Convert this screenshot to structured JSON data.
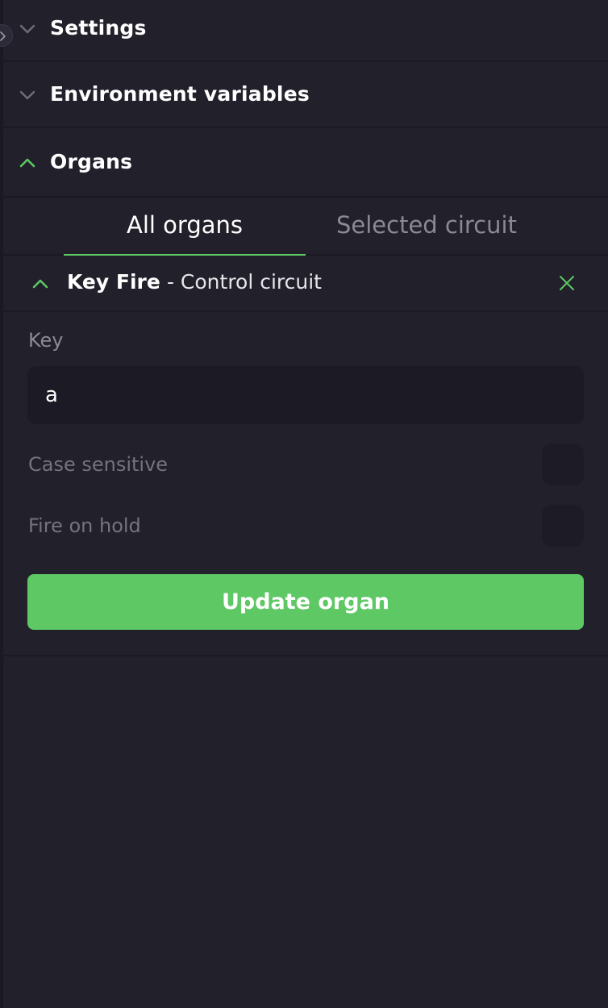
{
  "sections": {
    "settings": {
      "title": "Settings",
      "expanded": false
    },
    "environment": {
      "title": "Environment variables",
      "expanded": false
    },
    "organs": {
      "title": "Organs",
      "expanded": true
    }
  },
  "tabs": [
    {
      "label": "All organs",
      "active": true
    },
    {
      "label": "Selected circuit",
      "active": false
    }
  ],
  "organ": {
    "name": "Key Fire",
    "separator_text": " - Control circuit",
    "expanded": true
  },
  "form": {
    "key_label": "Key",
    "key_value": "a",
    "case_sensitive_label": "Case sensitive",
    "case_sensitive_checked": false,
    "fire_on_hold_label": "Fire on hold",
    "fire_on_hold_checked": false,
    "submit_label": "Update organ"
  },
  "colors": {
    "background": "#21202b",
    "accent": "#5ec864",
    "muted_text": "#8a8995"
  },
  "icons": {
    "collapsed": "chevron-down-icon",
    "expanded": "chevron-up-icon",
    "remove": "close-icon",
    "sidebar_toggle": "chevron-right-icon"
  }
}
